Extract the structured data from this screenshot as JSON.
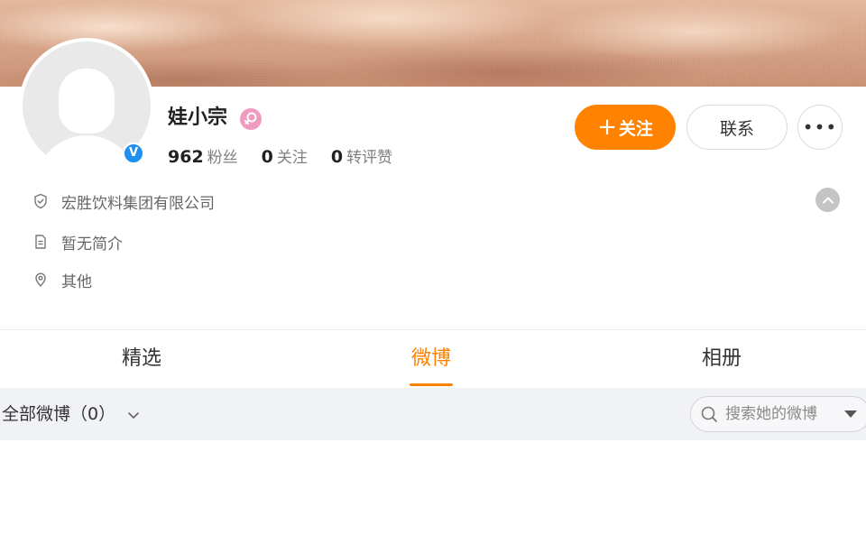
{
  "profile": {
    "name": "娃小宗",
    "gender_icon": "female-icon",
    "verified_badge_text": "V",
    "stats": [
      {
        "num": "962",
        "label": "粉丝"
      },
      {
        "num": "0",
        "label": "关注"
      },
      {
        "num": "0",
        "label": "转评赞"
      }
    ]
  },
  "actions": {
    "follow_plus": "+",
    "follow_label": "关注",
    "contact_label": "联系",
    "more_label": "•••"
  },
  "info": {
    "company": "宏胜饮料集团有限公司",
    "bio": "暂无简介",
    "location": "其他"
  },
  "tabs": [
    {
      "label": "精选"
    },
    {
      "label": "微博",
      "active": true
    },
    {
      "label": "相册"
    }
  ],
  "filter": {
    "label": "全部微博（0）"
  },
  "search": {
    "placeholder": "搜索她的微博"
  },
  "colors": {
    "accent": "#ff8200",
    "verified": "#1e8ff0",
    "gender": "#f19ac0"
  }
}
